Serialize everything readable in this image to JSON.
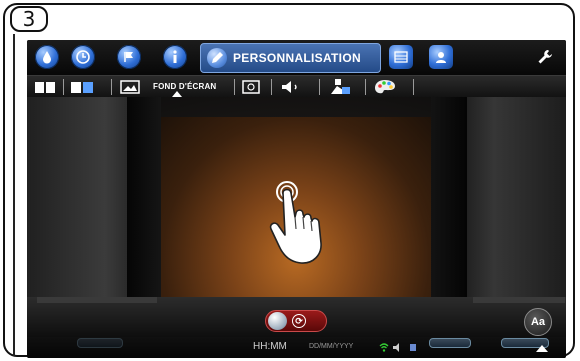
{
  "step": {
    "number": "3"
  },
  "topbar": {
    "active_tab_label": "PERSONNALISATION",
    "icons": [
      "drop-icon",
      "clock-icon",
      "flag-icon",
      "info-icon",
      "pencil-icon",
      "grid-icon",
      "person-icon",
      "wrench-icon"
    ]
  },
  "subbar": {
    "active_label": "FOND D'ÉCRAN",
    "icons": [
      "book-icon",
      "photo-book-icon",
      "wallpaper-icon",
      "frame-icon",
      "speaker-icon",
      "brightness-icon",
      "palette-icon"
    ]
  },
  "status": {
    "time": "HH:MM",
    "date": "DD/MM/YYYY"
  },
  "controls": {
    "aa_label": "Aa"
  },
  "colors": {
    "accent": "#2f6ed6",
    "toggle": "#9a1a1a"
  }
}
